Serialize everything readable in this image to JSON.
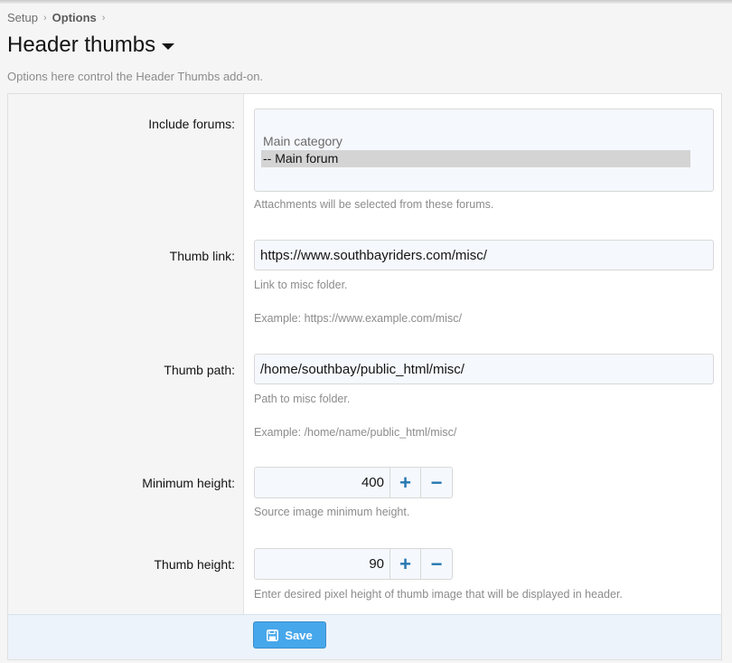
{
  "breadcrumb": {
    "items": [
      {
        "label": "Setup"
      },
      {
        "label": "Options"
      }
    ],
    "separator": "›"
  },
  "page": {
    "title": "Header thumbs",
    "description": "Options here control the Header Thumbs add-on."
  },
  "options": {
    "include_forums": {
      "label": "Include forums:",
      "group_label": "Main category",
      "selected_option": "-- Main forum",
      "explain": "Attachments will be selected from these forums."
    },
    "thumb_link": {
      "label": "Thumb link:",
      "value": "https://www.southbayriders.com/misc/",
      "explain": "Link to misc folder.",
      "example": "Example: https://www.example.com/misc/"
    },
    "thumb_path": {
      "label": "Thumb path:",
      "value": "/home/southbay/public_html/misc/",
      "explain": "Path to misc folder.",
      "example": "Example: /home/name/public_html/misc/"
    },
    "minimum_height": {
      "label": "Minimum height:",
      "value": "400",
      "explain": "Source image minimum height."
    },
    "thumb_height": {
      "label": "Thumb height:",
      "value": "90",
      "explain": "Enter desired pixel height of thumb image that will be displayed in header."
    }
  },
  "spin": {
    "plus": "+",
    "minus": "−"
  },
  "footer": {
    "save_label": "Save"
  },
  "colors": {
    "accent": "#47a7eb",
    "spin_button": "#2577b1",
    "footer_bg": "#edf3fa"
  }
}
